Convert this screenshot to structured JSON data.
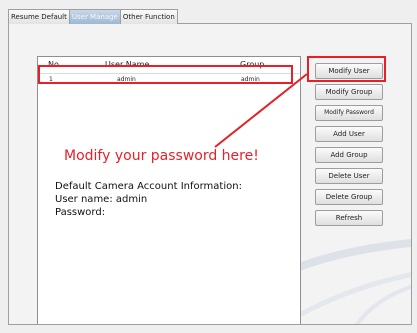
{
  "tabs": [
    {
      "label": "Resume Default"
    },
    {
      "label": "User Manage"
    },
    {
      "label": "Other Function"
    }
  ],
  "table": {
    "headers": {
      "no": "No.",
      "user_name": "User Name",
      "group": "Group"
    },
    "rows": [
      {
        "no": "1",
        "user_name": "admin",
        "group": "admin"
      }
    ]
  },
  "buttons": {
    "modify_user": "Modify User",
    "modify_group": "Modify Group",
    "modify_password": "Modify Password",
    "add_user": "Add User",
    "add_group": "Add Group",
    "delete_user": "Delete User",
    "delete_group": "Delete Group",
    "refresh": "Refresh"
  },
  "annotation": {
    "text": "Modify your password here!",
    "color": "#e81f27"
  },
  "info": {
    "line1": "Default Camera Account Information:",
    "line2": "User name: admin",
    "line3": "Password:"
  }
}
